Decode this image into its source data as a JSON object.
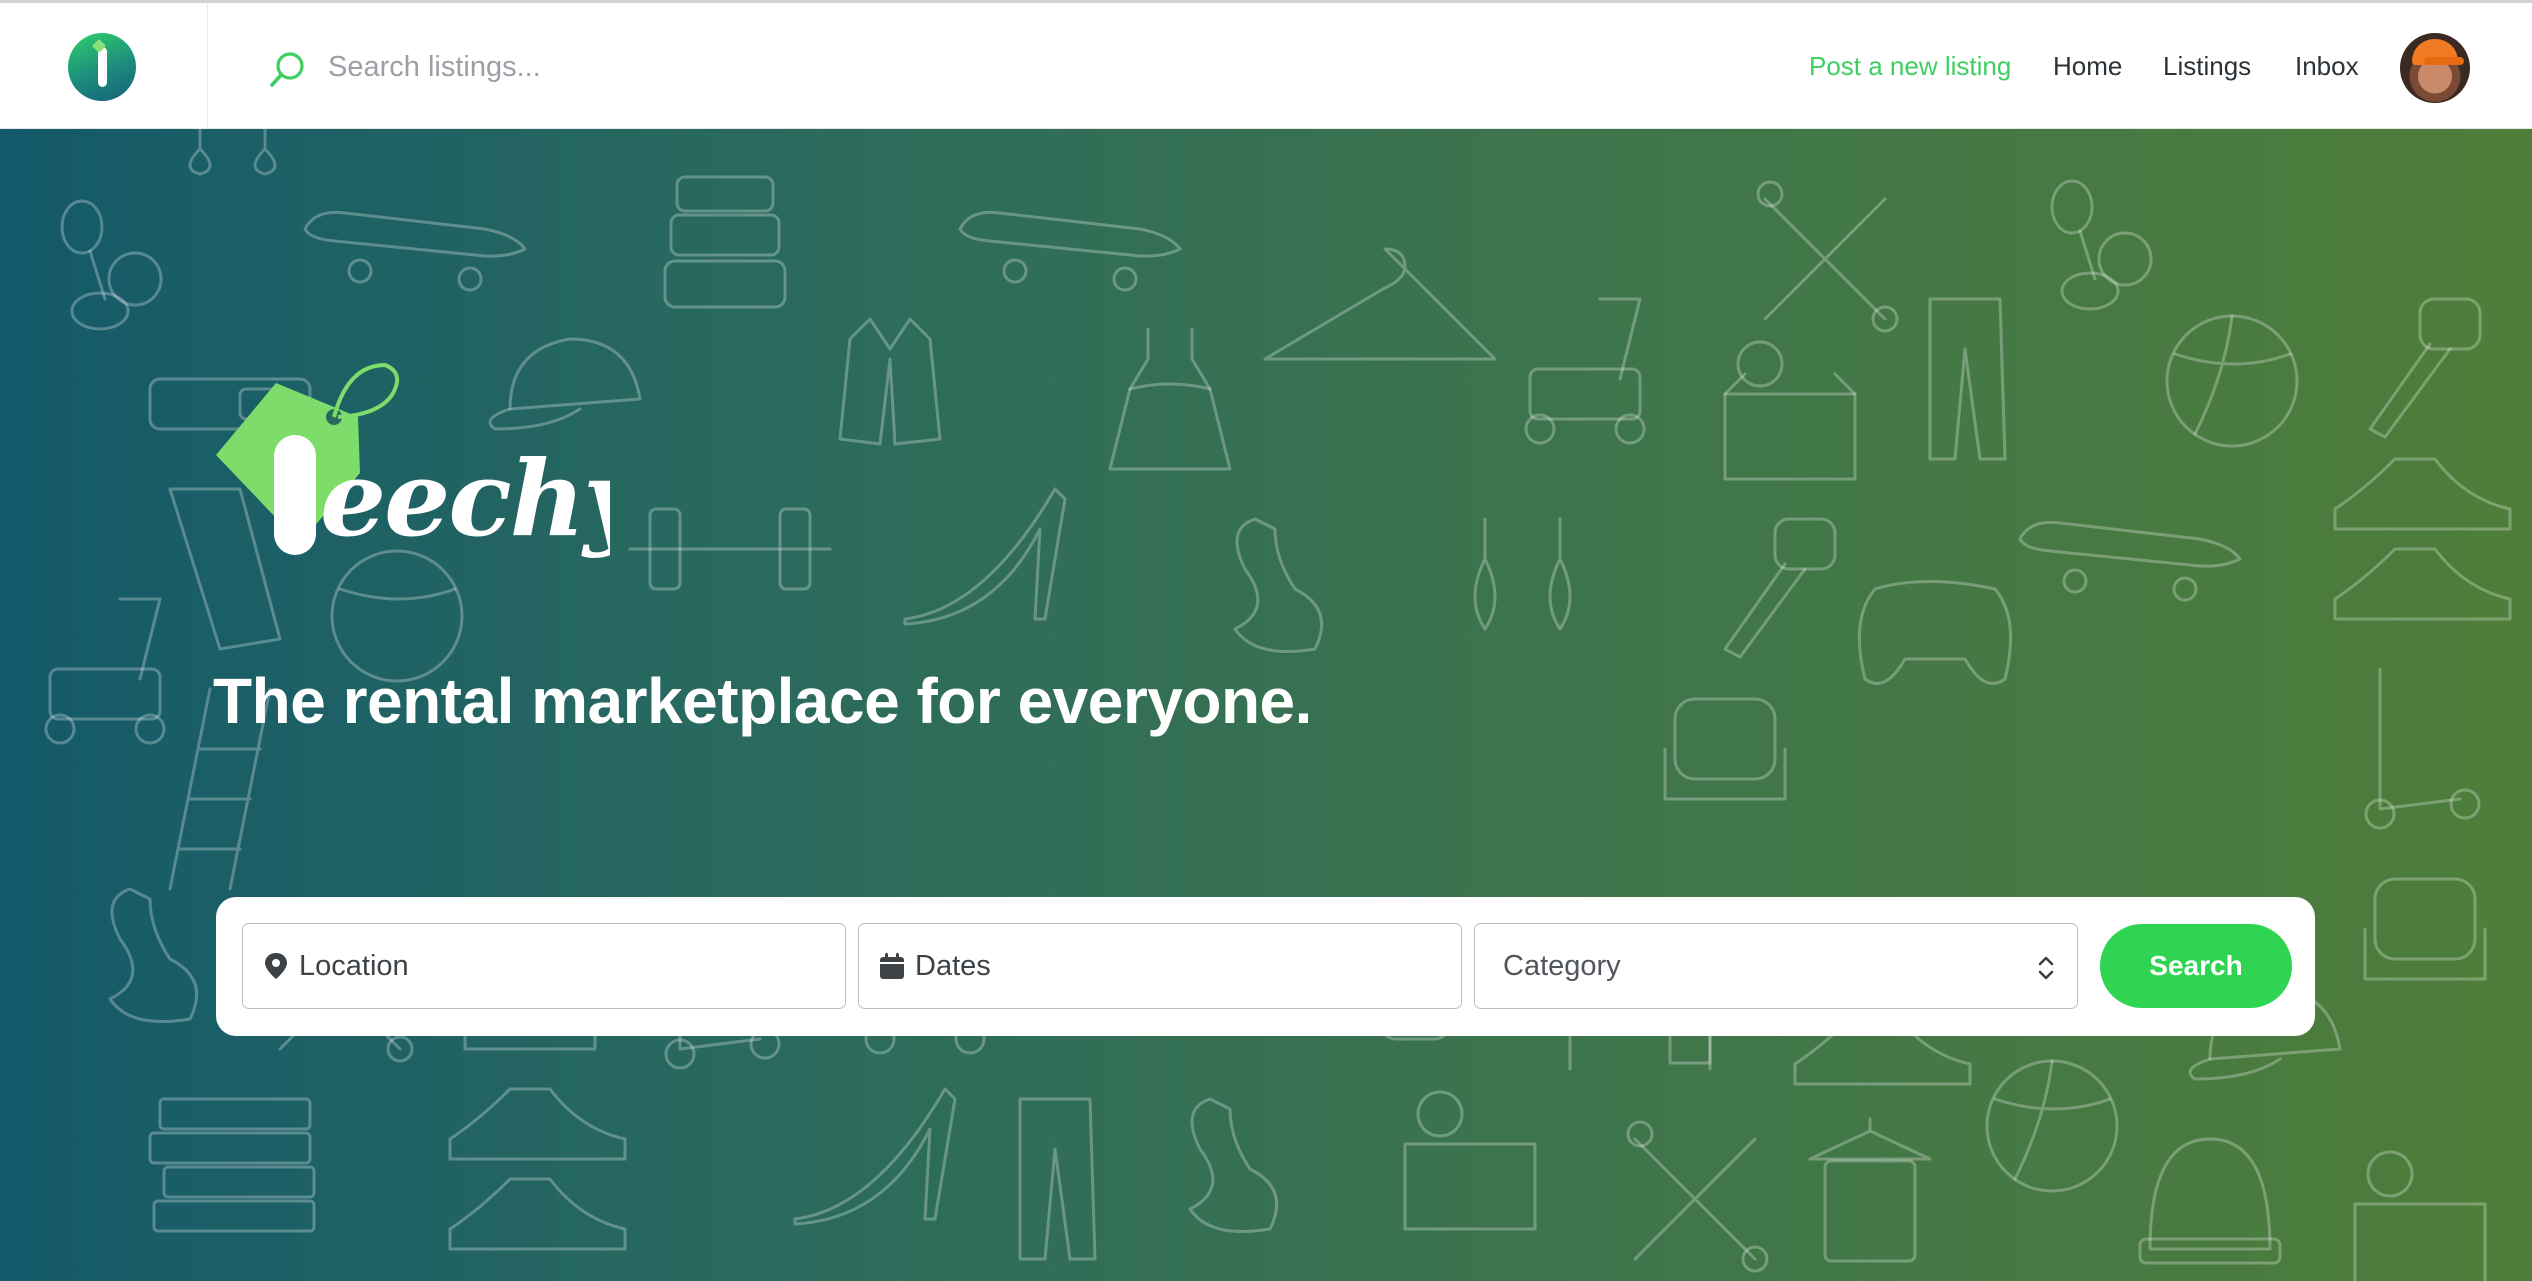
{
  "header": {
    "search_placeholder": "Search listings...",
    "nav": {
      "post": "Post a new listing",
      "home": "Home",
      "listings": "Listings",
      "inbox": "Inbox"
    },
    "icons": {
      "logo": "leechy-logo-icon",
      "search": "search-icon",
      "avatar": "user-avatar"
    },
    "colors": {
      "accent": "#3fce62",
      "nav_text": "#2c3338"
    }
  },
  "hero": {
    "brand_name": "leechy.",
    "tagline": "The rental marketplace for everyone.",
    "gradient": [
      "#14596a",
      "#4e7e3a"
    ],
    "search_form": {
      "location_label": "Location",
      "dates_label": "Dates",
      "category_label": "Category",
      "button_label": "Search",
      "button_color": "#2fd552"
    }
  }
}
